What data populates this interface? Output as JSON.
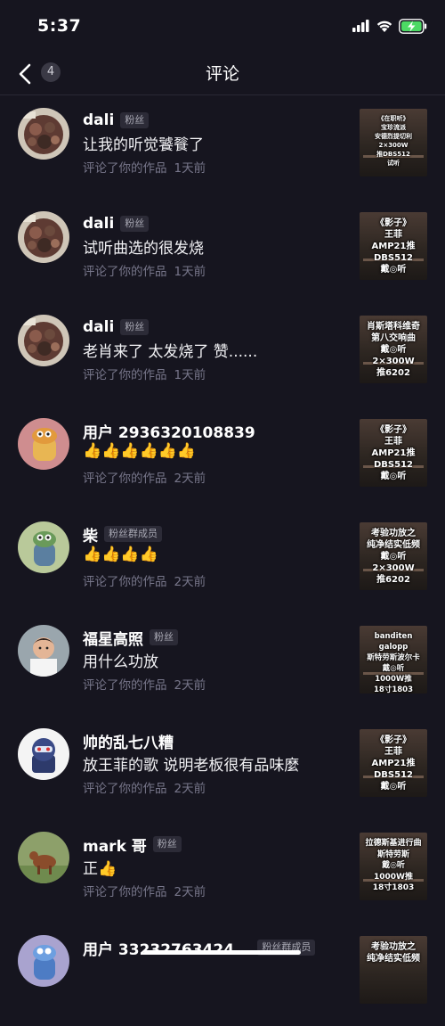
{
  "status": {
    "time": "5:37"
  },
  "header": {
    "title": "评论",
    "badge": "4"
  },
  "comments": [
    {
      "name": "dali",
      "tag": "粉丝",
      "text": "让我的听觉饕餮了",
      "action": "评论了你的作品",
      "time": "1天前",
      "avatar": "food-photo-avatar",
      "thumb_text": "《在职听》\n宝珍流派\n安德烈提切利\n2×300W\n推DBS512\n试听"
    },
    {
      "name": "dali",
      "tag": "粉丝",
      "text": "试听曲选的很发烧",
      "action": "评论了你的作品",
      "time": "1天前",
      "avatar": "food-photo-avatar",
      "thumb_text": "《影子》\n王菲\nAMP21推\nDBS512\n戴◎听"
    },
    {
      "name": "dali",
      "tag": "粉丝",
      "text": "老肖来了 太发烧了 赞......",
      "action": "评论了你的作品",
      "time": "1天前",
      "avatar": "food-photo-avatar",
      "thumb_text": "肖斯塔科维奇\n第八交响曲\n戴◎听\n2×300W\n推6202"
    },
    {
      "name": "用户 2936320108839",
      "tag": "",
      "text": "👍👍👍👍👍👍",
      "action": "评论了你的作品",
      "time": "2天前",
      "avatar": "cartoon-avatar",
      "thumb_text": "《影子》\n王菲\nAMP21推\nDBS512\n戴◎听"
    },
    {
      "name": "柴",
      "tag": "粉丝群成员",
      "text": "👍👍👍👍",
      "action": "评论了你的作品",
      "time": "2天前",
      "avatar": "cartoon-avatar",
      "thumb_text": "考验功放之\n纯净结实低频\n戴◎听\n2×300W\n推6202"
    },
    {
      "name": "福星高照",
      "tag": "粉丝",
      "text": "用什么功放",
      "action": "评论了你的作品",
      "time": "2天前",
      "avatar": "child-photo-avatar",
      "thumb_text": "banditen galopp\n斯特劳斯波尔卡\n戴◎听\n1000W推\n18寸1803"
    },
    {
      "name": "帅的乱七八糟",
      "tag": "",
      "text": "放王菲的歌 说明老板很有品味麼",
      "action": "评论了你的作品",
      "time": "2天前",
      "avatar": "robot-avatar",
      "thumb_text": "《影子》\n王菲\nAMP21推\nDBS512\n戴◎听"
    },
    {
      "name": "mark 哥",
      "tag": "粉丝",
      "text": "正👍",
      "action": "评论了你的作品",
      "time": "2天前",
      "avatar": "cow-photo-avatar",
      "thumb_text": "拉德斯基进行曲\n斯特劳斯\n戴◎听\n1000W推\n18寸1803"
    },
    {
      "name": "用户 33232763424...",
      "tag": "粉丝群成员",
      "text": "",
      "action": "",
      "time": "",
      "avatar": "cartoon-avatar",
      "thumb_text": "考验功放之\n纯净结实低频"
    }
  ],
  "colors": {
    "background": "#16151f",
    "tag_bg": "#2c2b37",
    "meta": "#77768a",
    "battery": "#4cd964"
  }
}
